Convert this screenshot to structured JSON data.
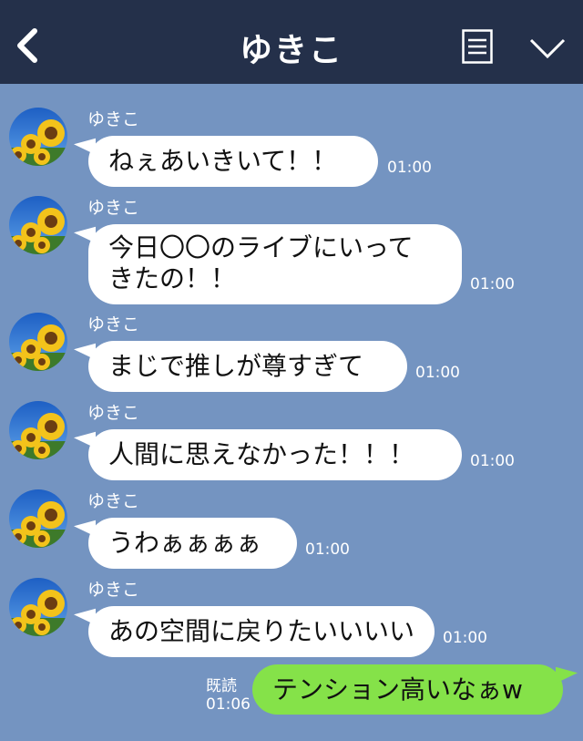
{
  "header": {
    "title": "ゆきこ",
    "back_icon": "back-chevron-icon",
    "menu_icon": "menu-icon",
    "expand_icon": "chevron-down-icon",
    "background": "#24304a"
  },
  "chat": {
    "background": "#7494c1",
    "messages": [
      {
        "sender": "ゆきこ",
        "lines": [
          "ねぇあいきいて！！"
        ],
        "time": "01:00"
      },
      {
        "sender": "ゆきこ",
        "lines": [
          "今日〇〇のライブにいって",
          "きたの！！"
        ],
        "time": "01:00"
      },
      {
        "sender": "ゆきこ",
        "lines": [
          "まじで推しが尊すぎて"
        ],
        "time": "01:00"
      },
      {
        "sender": "ゆきこ",
        "lines": [
          "人間に思えなかった！！！"
        ],
        "time": "01:00"
      },
      {
        "sender": "ゆきこ",
        "lines": [
          "うわぁぁぁぁ"
        ],
        "time": "01:00"
      },
      {
        "sender": "ゆきこ",
        "lines": [
          "あの空間に戻りたいいいい"
        ],
        "time": "01:00"
      }
    ],
    "my_message": {
      "text": "テンション高いなぁw",
      "read_label": "既読",
      "time": "01:06",
      "color": "#85e249"
    },
    "avatar_icon": "sunflower-avatar-icon"
  }
}
